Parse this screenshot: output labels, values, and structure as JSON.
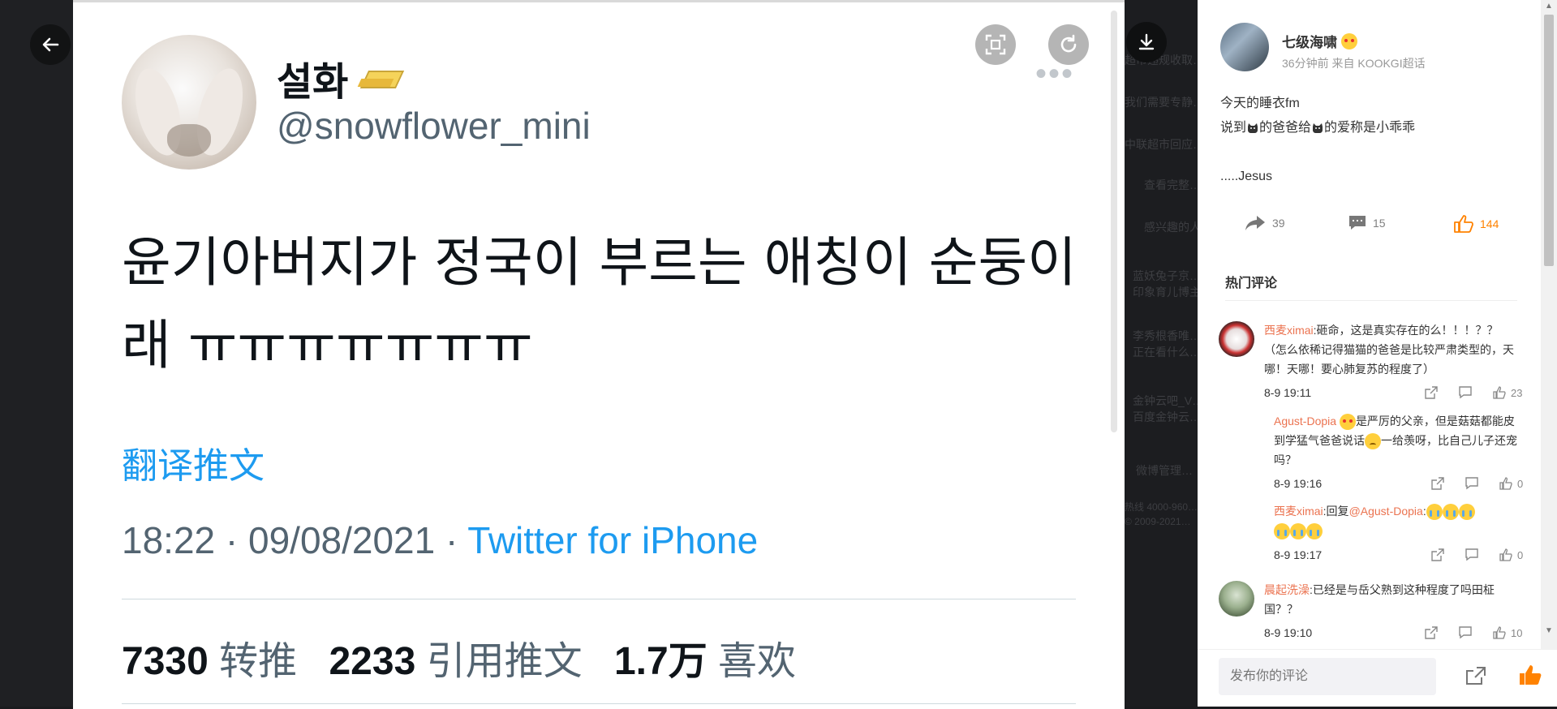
{
  "tweet": {
    "display_name": "설화",
    "handle": "@snowflower_mini",
    "text_line1": "윤기아버지가 정국이 부르는 애칭이 순둥이",
    "text_line2": "래 ㅠㅠㅠㅠㅠㅠㅠ",
    "translate": "翻译推文",
    "time": "18:22 · 09/08/2021 · ",
    "via": "Twitter for iPhone",
    "retweets_count": "7330",
    "retweets_label": "转推",
    "quotes_count": "2233",
    "quotes_label": "引用推文",
    "likes_count": "1.7万",
    "likes_label": "喜欢",
    "more": "•••"
  },
  "background_strip": [
    "超市违规收取…",
    "我们需要专静…",
    "中联超市回应…",
    "查看完整…",
    "感兴趣的人",
    "蓝妖兔子京…",
    "印象育儿博主",
    "李秀根香唯…",
    "正在看什么…",
    "金钟云吧_V…",
    "百度金钟云…",
    "微博管理…",
    "热线 4000-960…",
    "© 2009-2021…"
  ],
  "post": {
    "username": "七级海啸",
    "meta": "36分钟前  来自 KOOKGI超话",
    "line1": "今天的睡衣fm",
    "line2a": "说到",
    "line2b": "的爸爸给",
    "line2c": "的爱称是小乖乖",
    "line3": ".....Jesus",
    "shares": "39",
    "comments": "15",
    "likes": "144"
  },
  "hot_title": "热门评论",
  "comments": [
    {
      "nick": "西麦ximai",
      "text": ":砸命，这是真实存在的么！！！？？（怎么依稀记得猫猫的爸爸是比较严肃类型的，天哪！天哪！要心肺复苏的程度了）",
      "time": "8-9 19:11",
      "likes": "23"
    },
    {
      "nick": "Agust-Dopia",
      "text_a": "是严厉的父亲，但是菇菇都能皮到学猛气爸爸说话",
      "text_b": "一给羡呀，比自己儿子还宠吗？",
      "time": "8-9 19:16",
      "likes": "0"
    },
    {
      "nick": "西麦ximai",
      "text": ":回复",
      "mention": "@Agust-Dopia",
      "time": "8-9 19:17",
      "likes": "0"
    },
    {
      "nick": "晨起洗澡",
      "text": ":已经是与岳父熟到这种程度了吗田柾国？？",
      "time": "8-9 19:10",
      "likes": "10"
    }
  ],
  "input_placeholder": "发布你的评论",
  "colors": {
    "accent": "#1d9bf0",
    "weibo_orange": "#ff8200",
    "nick": "#eb7350"
  }
}
